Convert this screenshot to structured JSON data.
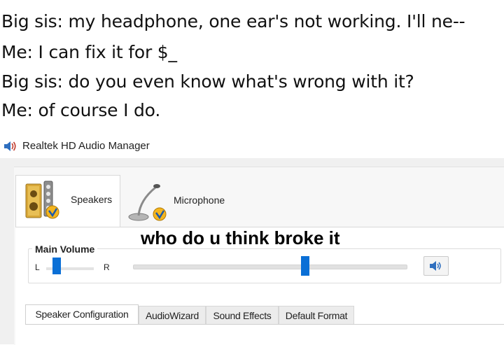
{
  "caption": {
    "lines": [
      "Big sis: my headphone, one ear's not working. I'll ne--",
      "Me: I can fix it for $_",
      "Big sis: do you even know what's wrong with it?",
      "Me: of course I do."
    ]
  },
  "window": {
    "title": "Realtek HD Audio Manager",
    "icon": "speaker-icon"
  },
  "device_tabs": [
    {
      "label": "Speakers",
      "icon": "speakers-device-icon",
      "active": true
    },
    {
      "label": "Microphone",
      "icon": "microphone-device-icon",
      "active": false
    }
  ],
  "overlay_text": "who do u think broke it",
  "volume": {
    "legend": "Main Volume",
    "left_label": "L",
    "right_label": "R",
    "balance_level": 0.2,
    "volume_level": 0.63,
    "mute_icon": "speaker-volume-icon",
    "accent_color": "#0a6fd6"
  },
  "bottom_tabs": [
    {
      "label": "Speaker Configuration",
      "active": true
    },
    {
      "label": "AudioWizard",
      "active": false
    },
    {
      "label": "Sound Effects",
      "active": false
    },
    {
      "label": "Default Format",
      "active": false
    }
  ]
}
